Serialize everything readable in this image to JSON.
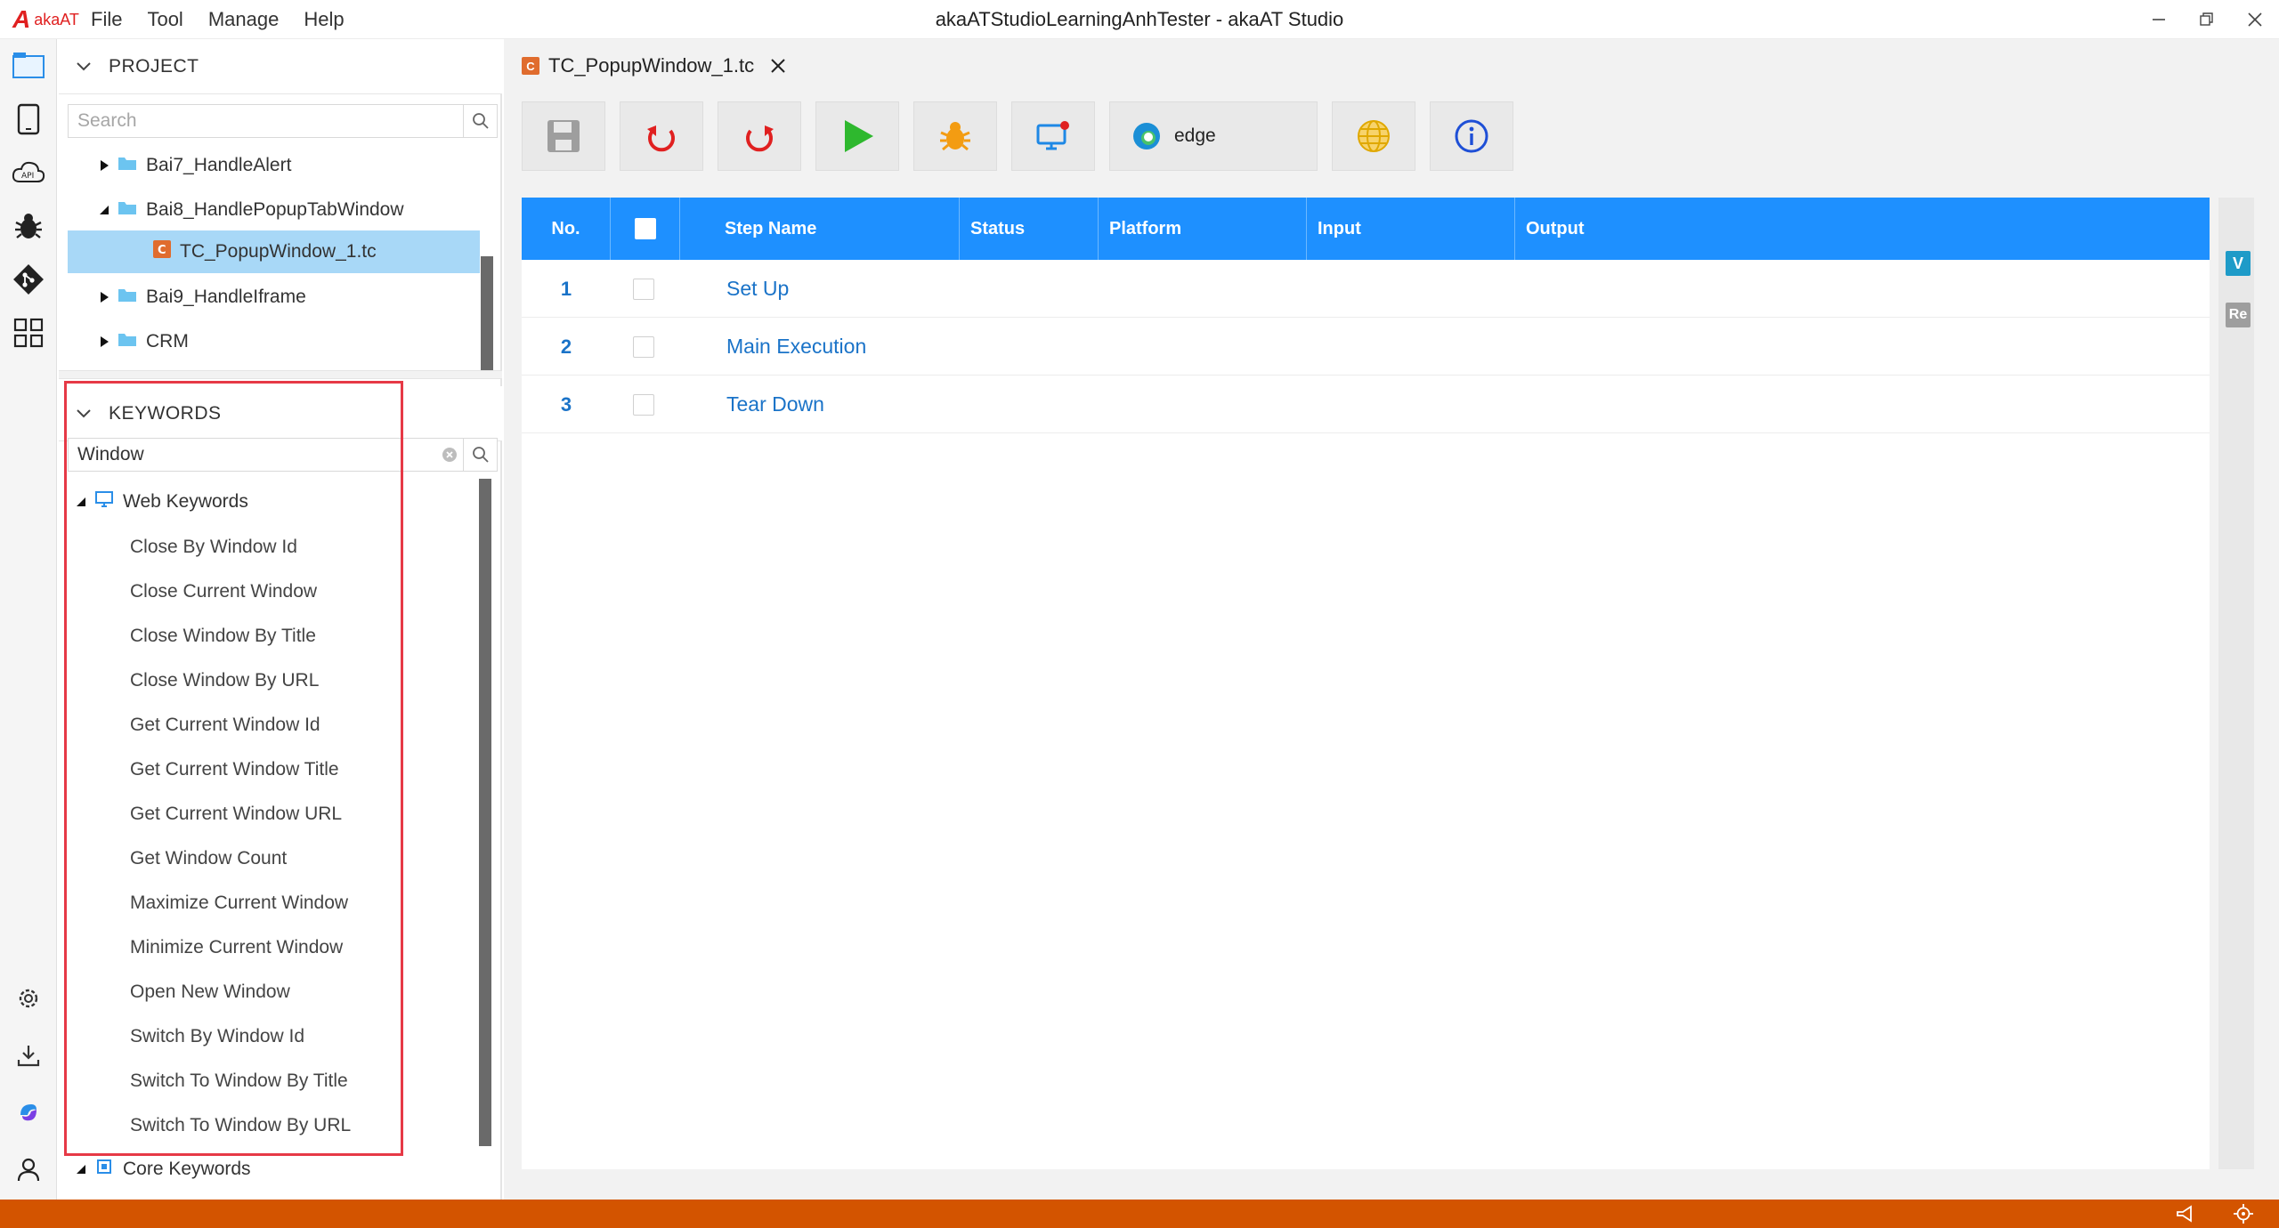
{
  "app": {
    "logo_text": "akaAT",
    "window_title": "akaATStudioLearningAnhTester - akaAT Studio",
    "menu": [
      "File",
      "Tool",
      "Manage",
      "Help"
    ]
  },
  "project": {
    "header": "PROJECT",
    "search_placeholder": "Search",
    "tree": [
      {
        "label": "Bai7_HandleAlert",
        "expanded": false
      },
      {
        "label": "Bai8_HandlePopupTabWindow",
        "expanded": true
      },
      {
        "label": "TC_PopupWindow_1.tc",
        "selected": true
      },
      {
        "label": "Bai9_HandleIframe",
        "expanded": false
      },
      {
        "label": "CRM",
        "expanded": false
      }
    ]
  },
  "keywords": {
    "header": "KEYWORDS",
    "search_value": "Window",
    "group": "Web Keywords",
    "items": [
      "Close By Window Id",
      "Close Current Window",
      "Close Window By Title",
      "Close Window By URL",
      "Get Current Window Id",
      "Get Current Window Title",
      "Get Current Window URL",
      "Get Window Count",
      "Maximize Current Window",
      "Minimize Current Window",
      "Open New Window",
      "Switch By Window Id",
      "Switch To Window By Title",
      "Switch To Window By URL"
    ],
    "next_group": "Core Keywords"
  },
  "editor": {
    "tab_label": "TC_PopupWindow_1.tc",
    "tab_icon_letter": "C",
    "browser": "edge",
    "columns": [
      "No.",
      "Step Name",
      "Status",
      "Platform",
      "Input",
      "Output"
    ],
    "rows": [
      {
        "no": "1",
        "name": "Set Up"
      },
      {
        "no": "2",
        "name": "Main Execution"
      },
      {
        "no": "3",
        "name": "Tear Down"
      }
    ],
    "gutter_badges": [
      "V",
      "Re"
    ]
  },
  "colors": {
    "accent": "#1e90ff",
    "status_bar": "#d35400",
    "selection": "#a8d8f7",
    "highlight": "#e63946"
  }
}
